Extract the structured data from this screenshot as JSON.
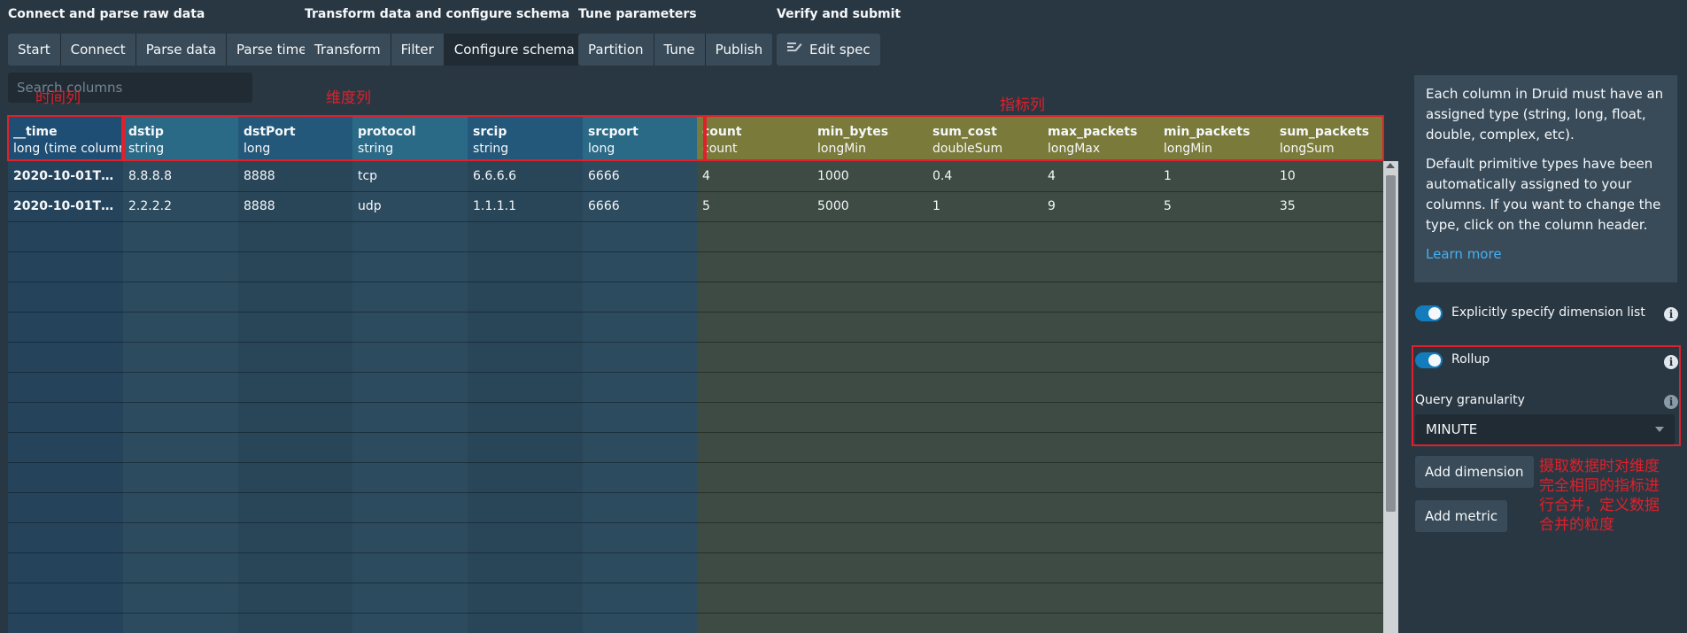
{
  "steps": [
    {
      "title": "Connect and parse raw data",
      "buttons": [
        "Start",
        "Connect",
        "Parse data",
        "Parse time"
      ]
    },
    {
      "title": "Transform data and configure schema",
      "buttons": [
        "Transform",
        "Filter",
        "Configure schema"
      ],
      "active": "Configure schema"
    },
    {
      "title": "Tune parameters",
      "buttons": [
        "Partition",
        "Tune",
        "Publish"
      ]
    },
    {
      "title": "Verify and submit",
      "buttons": [
        "Edit spec"
      ]
    }
  ],
  "search": {
    "placeholder": "Search columns"
  },
  "columns": [
    {
      "name": "__time",
      "type": "long (time column)",
      "cells": [
        "2020-10-01T00:...",
        "2020-10-01T00:..."
      ]
    },
    {
      "name": "dstip",
      "type": "string",
      "cells": [
        "8.8.8.8",
        "2.2.2.2"
      ]
    },
    {
      "name": "dstPort",
      "type": "long",
      "cells": [
        "8888",
        "8888"
      ]
    },
    {
      "name": "protocol",
      "type": "string",
      "cells": [
        "tcp",
        "udp"
      ]
    },
    {
      "name": "srcip",
      "type": "string",
      "cells": [
        "6.6.6.6",
        "1.1.1.1"
      ]
    },
    {
      "name": "srcport",
      "type": "long",
      "cells": [
        "6666",
        "6666"
      ]
    },
    {
      "name": "count",
      "type": "count",
      "cells": [
        "4",
        "5"
      ]
    },
    {
      "name": "min_bytes",
      "type": "longMin",
      "cells": [
        "1000",
        "5000"
      ]
    },
    {
      "name": "sum_cost",
      "type": "doubleSum",
      "cells": [
        "0.4",
        "1"
      ]
    },
    {
      "name": "max_packets",
      "type": "longMax",
      "cells": [
        "4",
        "9"
      ]
    },
    {
      "name": "min_packets",
      "type": "longMin",
      "cells": [
        "1",
        "5"
      ]
    },
    {
      "name": "sum_packets",
      "type": "longSum",
      "cells": [
        "10",
        "35"
      ]
    }
  ],
  "info": {
    "p1": "Each column in Druid must have an assigned type (string, long, float, double, complex, etc).",
    "p2": "Default primitive types have been automatically assigned to your columns. If you want to change the type, click on the column header.",
    "link": "Learn more"
  },
  "settings": {
    "explicit_dimensions": "Explicitly specify dimension list",
    "rollup": "Rollup",
    "query_granularity_label": "Query granularity",
    "query_granularity_value": "MINUTE",
    "add_dimension": "Add dimension",
    "add_metric": "Add metric"
  },
  "annotations": {
    "time_col": "时间列",
    "dimension_cols": "维度列",
    "metric_cols": "指标列",
    "rollup_note": "摄取数据时对维度完全相同的指标进行合并，定义数据合并的粒度",
    "color": "#e0202a"
  },
  "colors": {
    "time_header": "#1f4e74",
    "dimension_header": "#2b6a87",
    "dimension_header_alt": "#24587a",
    "metric_header": "#7a7a3a",
    "time_body": "#25445c",
    "dimension_body": "#2d4b5f",
    "metric_body": "#3e4a44"
  }
}
